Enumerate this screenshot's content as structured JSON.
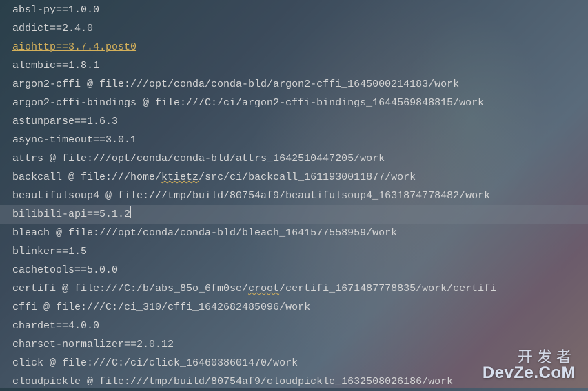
{
  "lines": [
    {
      "text": "absl-py==1.0.0",
      "style": "plain"
    },
    {
      "text": "addict==2.4.0",
      "style": "plain"
    },
    {
      "text": "aiohttp==3.7.4.post0",
      "style": "link"
    },
    {
      "text": "alembic==1.8.1",
      "style": "plain"
    },
    {
      "text": "argon2-cffi @ file:///opt/conda/conda-bld/argon2-cffi_1645000214183/work",
      "style": "plain"
    },
    {
      "text": "argon2-cffi-bindings @ file:///C:/ci/argon2-cffi-bindings_1644569848815/work",
      "style": "plain"
    },
    {
      "text": "astunparse==1.6.3",
      "style": "plain"
    },
    {
      "text": "async-timeout==3.0.1",
      "style": "plain"
    },
    {
      "text": "attrs @ file:///opt/conda/conda-bld/attrs_1642510447205/work",
      "style": "plain"
    },
    {
      "text": "backcall @ file:///home/|ktietz|/src/ci/backcall_1611930011877/work",
      "style": "plain"
    },
    {
      "text": "beautifulsoup4 @ file:///tmp/build/80754af9/beautifulsoup4_1631874778482/work",
      "style": "plain"
    },
    {
      "text": "bilibili-api==5.1.2",
      "style": "highlighted"
    },
    {
      "text": "bleach @ file:///opt/conda/conda-bld/bleach_1641577558959/work",
      "style": "plain"
    },
    {
      "text": "blinker==1.5",
      "style": "plain"
    },
    {
      "text": "cachetools==5.0.0",
      "style": "plain"
    },
    {
      "text": "certifi @ file:///C:/b/abs_85o_6fm0se/|croot|/certifi_1671487778835/work/certifi",
      "style": "plain"
    },
    {
      "text": "cffi @ file:///C:/ci_310/cffi_1642682485096/work",
      "style": "plain"
    },
    {
      "text": "chardet==4.0.0",
      "style": "plain"
    },
    {
      "text": "charset-normalizer==2.0.12",
      "style": "plain"
    },
    {
      "text": "click @ file:///C:/ci/click_1646038601470/work",
      "style": "plain"
    },
    {
      "text": "cloudpickle @ file:///tmp/build/80754af9/cloudpickle_1632508026186/work",
      "style": "plain"
    }
  ],
  "watermark": {
    "cn": "开发者",
    "en": "DevZe.CoM"
  }
}
